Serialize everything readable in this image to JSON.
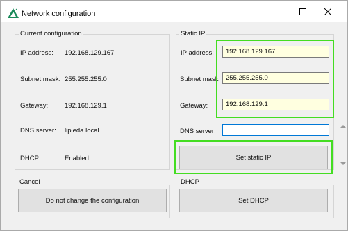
{
  "window": {
    "title": "Network configuration",
    "icon": "triangle-logo-icon",
    "controls": [
      "minimize-icon",
      "maximize-icon",
      "close-icon"
    ]
  },
  "current_config": {
    "legend": "Current configuration",
    "ip_label": "IP address:",
    "ip_value": "192.168.129.167",
    "mask_label": "Subnet mask:",
    "mask_value": "255.255.255.0",
    "gateway_label": "Gateway:",
    "gateway_value": "192.168.129.1",
    "dns_label": "DNS server:",
    "dns_value": "lipieda.local",
    "dhcp_label": "DHCP:",
    "dhcp_value": "Enabled"
  },
  "static_ip": {
    "legend": "Static IP",
    "ip_label": "IP address:",
    "ip_value": "192.168.129.167",
    "mask_label": "Subnet mask",
    "mask_value": "255.255.255.0",
    "gateway_label": "Gateway:",
    "gateway_value": "192.168.129.1",
    "dns_label": "DNS server:",
    "dns_value": "",
    "set_button": "Set static IP"
  },
  "cancel": {
    "legend": "Cancel",
    "button": "Do not change the configuration"
  },
  "dhcp": {
    "legend": "DHCP",
    "button": "Set DHCP"
  },
  "colors": {
    "highlight": "#44dd22",
    "field_background": "#ffffe0",
    "focus_border": "#0078d7"
  }
}
